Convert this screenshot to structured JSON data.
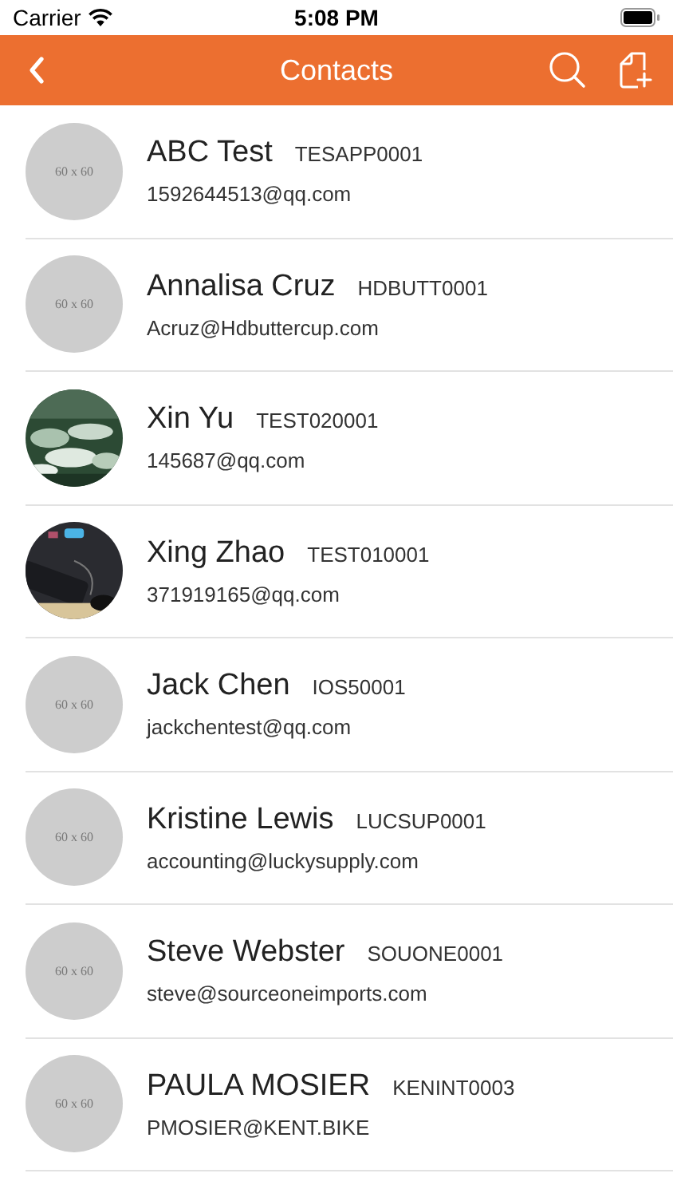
{
  "status_bar": {
    "carrier": "Carrier",
    "time": "5:08 PM"
  },
  "nav_bar": {
    "title": "Contacts"
  },
  "contacts": [
    {
      "name": "ABC Test",
      "code": "TESAPP0001",
      "email": "1592644513@qq.com",
      "avatar": {
        "kind": "placeholder",
        "text": "60 x 60"
      }
    },
    {
      "name": "Annalisa Cruz",
      "code": "HDBUTT0001",
      "email": "Acruz@Hdbuttercup.com",
      "avatar": {
        "kind": "placeholder",
        "text": "60 x 60"
      }
    },
    {
      "name": "Xin Yu",
      "code": "TEST020001",
      "email": "145687@qq.com"
    },
    {
      "name": "Xing Zhao",
      "code": "TEST010001",
      "email": "371919165@qq.com"
    },
    {
      "name": "Jack Chen",
      "code": "IOS50001",
      "email": "jackchentest@qq.com",
      "avatar": {
        "kind": "placeholder",
        "text": "60 x 60"
      }
    },
    {
      "name": "Kristine Lewis",
      "code": "LUCSUP0001",
      "email": "accounting@luckysupply.com",
      "avatar": {
        "kind": "placeholder",
        "text": "60 x 60"
      }
    },
    {
      "name": "Steve Webster",
      "code": "SOUONE0001",
      "email": "steve@sourceoneimports.com",
      "avatar": {
        "kind": "placeholder",
        "text": "60 x 60"
      }
    },
    {
      "name": "PAULA MOSIER",
      "code": "KENINT0003",
      "email": "PMOSIER@KENT.BIKE",
      "avatar": {
        "kind": "placeholder",
        "text": "60 x 60"
      }
    }
  ]
}
